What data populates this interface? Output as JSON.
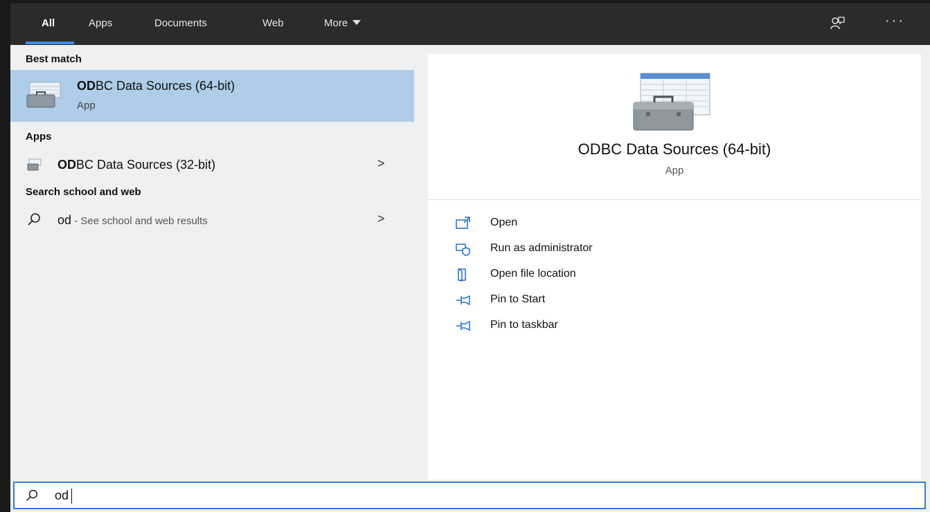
{
  "tabs": [
    {
      "label": "All",
      "active": true
    },
    {
      "label": "Apps",
      "active": false
    },
    {
      "label": "Documents",
      "active": false
    },
    {
      "label": "Web",
      "active": false
    },
    {
      "label": "More",
      "active": false
    }
  ],
  "topbar": {
    "more_options_label": "···",
    "feedback_icon": "feedback-icon"
  },
  "left": {
    "best_match_header": "Best match",
    "best_match": {
      "title_bold": "OD",
      "title_rest": "BC Data Sources (64-bit)",
      "subtitle": "App",
      "icon": "database-toolbox-icon"
    },
    "apps_header": "Apps",
    "apps": [
      {
        "title_bold": "OD",
        "title_rest": "BC Data Sources (32-bit)",
        "icon": "database-toolbox-icon"
      }
    ],
    "web_header": "Search school and web",
    "web_result": {
      "query": "od",
      "suffix": " - See school and web results"
    }
  },
  "preview": {
    "title": "ODBC Data Sources (64-bit)",
    "subtitle": "App",
    "actions": [
      {
        "label": "Open",
        "icon": "open-icon"
      },
      {
        "label": "Run as administrator",
        "icon": "shield-icon"
      },
      {
        "label": "Open file location",
        "icon": "folder-icon"
      },
      {
        "label": "Pin to Start",
        "icon": "pin-icon"
      },
      {
        "label": "Pin to taskbar",
        "icon": "pin-icon"
      }
    ]
  },
  "search": {
    "value": "od"
  },
  "colors": {
    "accent": "#3d8ee6",
    "selected_bg": "#aecde8",
    "action_icon": "#1f6fd1"
  }
}
